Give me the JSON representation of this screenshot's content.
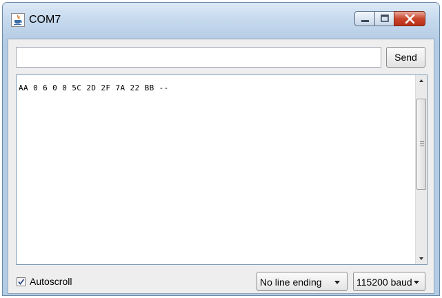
{
  "window": {
    "title": "COM7",
    "icon": "java-cup-icon"
  },
  "controls": {
    "minimize_icon": "minimize-icon",
    "maximize_icon": "maximize-icon",
    "close_icon": "close-icon"
  },
  "send": {
    "input_value": "",
    "button_label": "Send"
  },
  "output": {
    "text": "AA 0 6 0 0 5C 2D 2F 7A 22 BB --"
  },
  "footer": {
    "autoscroll_label": "Autoscroll",
    "autoscroll_checked": true,
    "line_ending": "No line ending",
    "baud_rate": "115200 baud"
  },
  "colors": {
    "close_button": "#c9462c",
    "titlebar": "#c7daee"
  }
}
